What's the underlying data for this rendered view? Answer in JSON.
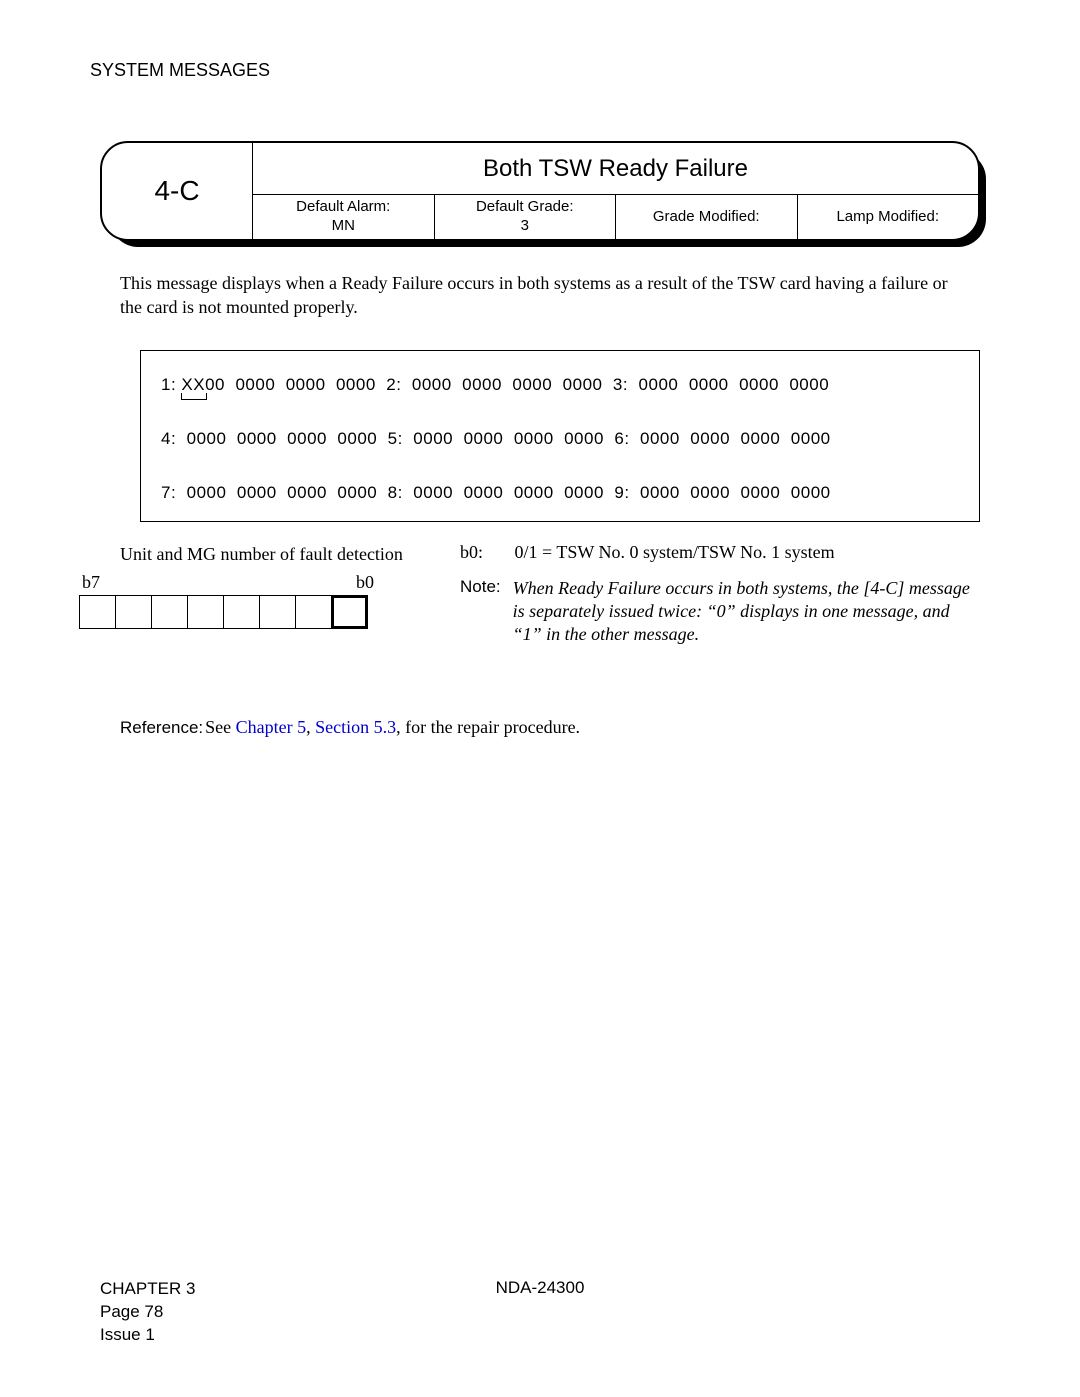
{
  "section_header": "SYSTEM MESSAGES",
  "code": "4-C",
  "title": "Both TSW Ready Failure",
  "meta": {
    "alarm_label": "Default Alarm:",
    "alarm_value": "MN",
    "grade_label": "Default Grade:",
    "grade_value": "3",
    "grade_mod_label": "Grade Modified:",
    "grade_mod_value": "",
    "lamp_mod_label": "Lamp Modified:",
    "lamp_mod_value": ""
  },
  "description": "This message displays when a Ready Failure occurs in both systems as a result of the TSW card having a failure or the card is not mounted properly.",
  "datarows": {
    "r1a": "1: ",
    "r1xx": "XX",
    "r1b": "00  0000  0000  0000  2:  0000  0000  0000  0000  3:  0000  0000  0000  0000",
    "r2": "4:  0000  0000  0000  0000  5:  0000  0000  0000  0000  6:  0000  0000  0000  0000",
    "r3": "7:  0000  0000  0000  0000  8:  0000  0000  0000  0000  9:  0000  0000  0000  0000"
  },
  "unit_label": "Unit and MG number of fault detection",
  "bit_hi": "b7",
  "bit_lo": "b0",
  "b0_label": "b0:",
  "b0_text": "0/1 = TSW No. 0 system/TSW No. 1 system",
  "note_label": "Note:",
  "note_text": "When Ready Failure occurs in both systems, the [4-C] message is separately issued twice: “0” displays in one message, and “1” in the other message.",
  "reference_label": "Reference:",
  "reference_pre": "See ",
  "reference_link1": "Chapter 5",
  "reference_sep": ", ",
  "reference_link2": "Section 5.3",
  "reference_post": ", for the repair procedure.",
  "footer": {
    "chapter": "CHAPTER 3",
    "doc": "NDA-24300",
    "page": "Page 78",
    "issue": "Issue 1"
  }
}
